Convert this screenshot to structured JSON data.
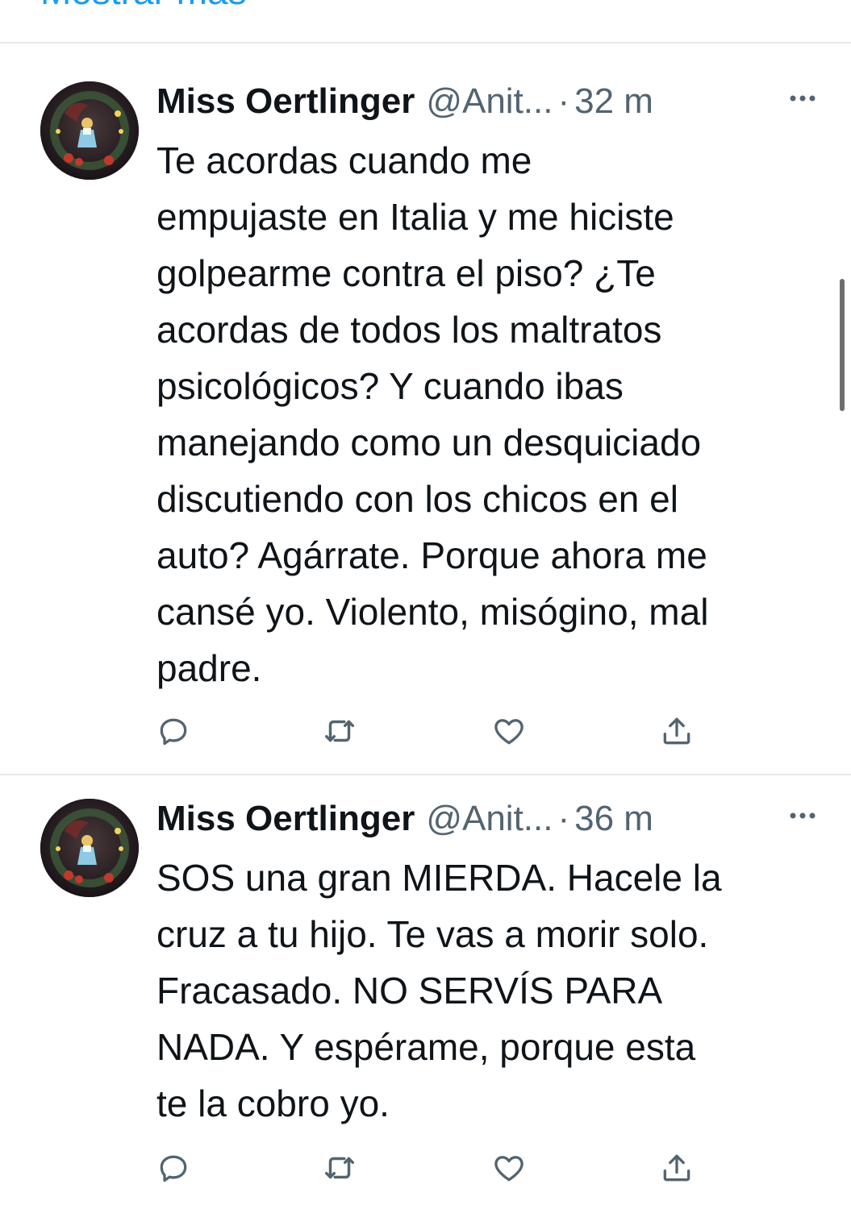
{
  "show_more_label": "Mostrar más",
  "colors": {
    "link": "#1d9bf0",
    "secondary_text": "#536471",
    "divider": "#e7e9ea"
  },
  "tweets": [
    {
      "display_name": "Miss Oertlinger",
      "handle": "@Anit...",
      "separator": "·",
      "time": "32 m",
      "text": "Te acordas cuando me\nempujaste en Italia y me hiciste\ngolpearme contra el piso? ¿Te\nacordas de todos los maltratos\npsicológicos? Y cuando ibas\nmanejando como un desquiciado\ndiscutiendo con los chicos en el\nauto? Agárrate. Porque ahora me\ncansé yo. Violento, misógino, mal\npadre.",
      "icons": [
        "reply-icon",
        "retweet-icon",
        "like-icon",
        "share-icon"
      ]
    },
    {
      "display_name": "Miss Oertlinger",
      "handle": "@Anit...",
      "separator": "·",
      "time": "36 m",
      "text": "SOS una gran MIERDA. Hacele la\ncruz a tu hijo. Te vas a morir solo.\nFracasado. NO SERVÍS PARA\nNADA. Y espérame, porque esta\nte la cobro yo.",
      "icons": [
        "reply-icon",
        "retweet-icon",
        "like-icon",
        "share-icon"
      ]
    }
  ]
}
